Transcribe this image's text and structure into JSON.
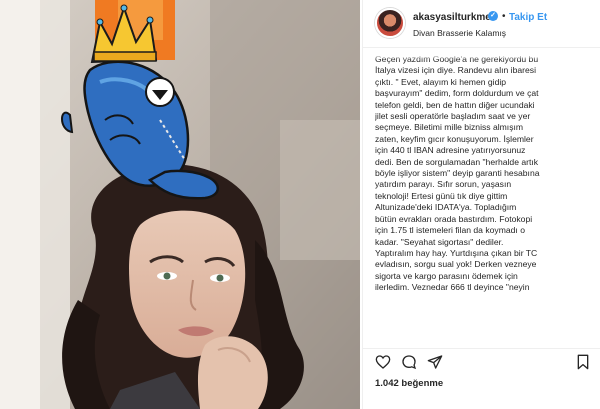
{
  "post": {
    "username": "akasyasilturkmen",
    "follow_label": "Takip Et",
    "separator": "•",
    "verified_mark": "✓",
    "location": "Divan Brasserie Kalamış",
    "caption": "Geçen yazdım Google'a ne gerekiyordu bu\nİtalya vizesi için diye. Randevu alın ibaresi\nçıktı. \" Evet, alayım ki hemen gidip\nbaşvurayım\" dedim, form doldurdum ve çat\ntelefon geldi, ben de hattın diğer ucundaki\njilet sesli operatörle başladım saat ve yer\nseçmeye. Biletimi mille bizniss almışım\nzaten, keyfim gıcır konuşuyorum. İşlemler\niçin 440 tl IBAN adresine yatırıyorsunuz\ndedi. Ben de sorgulamadan \"herhalde artık\nböyle işliyor sistem\" deyip garanti hesabına\nyatırdım parayı. Sıfır sorun, yaşasın\nteknoloji! Ertesi günü tık diye gittim\nAltunizade'deki IDATA'ya. Topladığım\nbütün evrakları orada bastırdım. Fotokopi\niçin 1.75 tl istemeleri filan da koymadı o\nkadar. \"Seyahat sigortası\" dediler.\nYaptıralım hay hay. Yurtdışına çıkan bir TC\nevladısın, sorgu sual yok! Derken vezneye\nsigorta ve kargo parasını ödemek için\nilerledim. Veznedar 666 tl deyince \"neyin",
    "likes": "1.042 beğenme"
  },
  "icons": {
    "like": "heart-icon",
    "comment": "comment-icon",
    "share": "share-icon",
    "save": "bookmark-icon"
  },
  "colors": {
    "accent": "#3897f0",
    "text": "#262626",
    "divider": "#efefef"
  }
}
